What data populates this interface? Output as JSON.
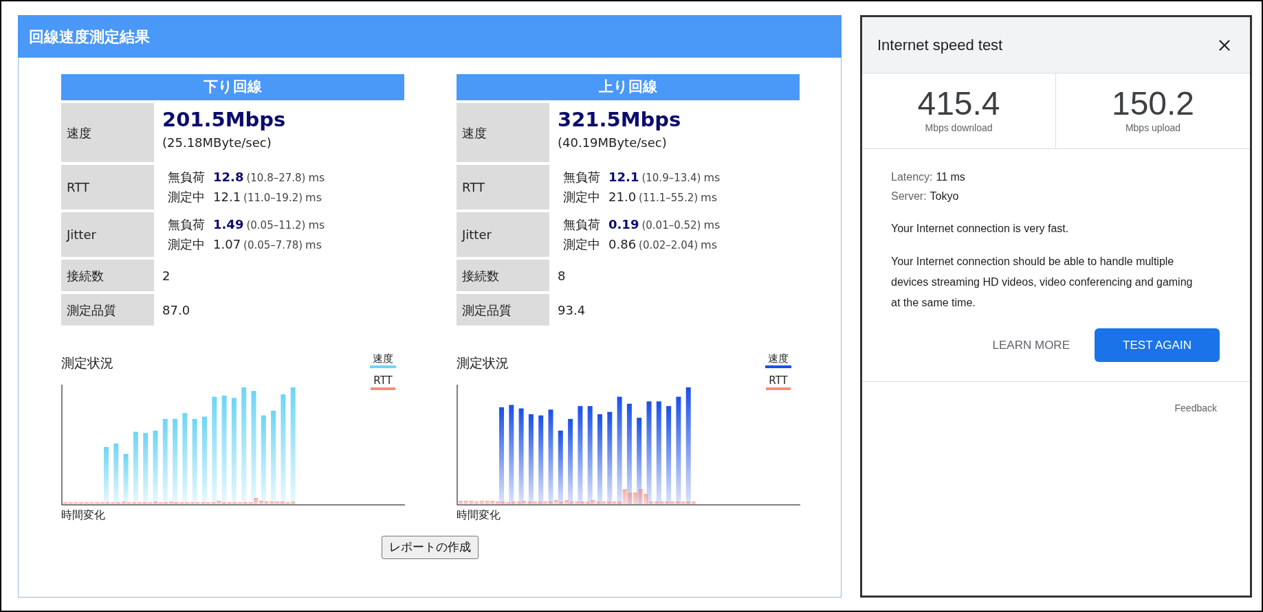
{
  "result_panel": {
    "title": "回線速度測定結果",
    "sections": [
      {
        "heading": "下り回線",
        "rows": [
          {
            "kind": "speed",
            "label": "速度",
            "value": "201.5Mbps",
            "sub": "(25.18MByte/sec)"
          },
          {
            "kind": "pair",
            "label": "RTT",
            "lines": [
              {
                "label": "無負荷",
                "value": "12.8",
                "range": "(10.8–27.8)",
                "unit": "ms",
                "highlight": true
              },
              {
                "label": "測定中",
                "value": "12.1",
                "range": "(11.0–19.2)",
                "unit": "ms",
                "highlight": false
              }
            ]
          },
          {
            "kind": "pair",
            "label": "Jitter",
            "lines": [
              {
                "label": "無負荷",
                "value": "1.49",
                "range": "(0.05–11.2)",
                "unit": "ms",
                "highlight": true
              },
              {
                "label": "測定中",
                "value": "1.07",
                "range": "(0.05–7.78)",
                "unit": "ms",
                "highlight": false
              }
            ]
          },
          {
            "kind": "plain",
            "label": "接続数",
            "value": "2"
          },
          {
            "kind": "plain",
            "label": "測定品質",
            "value": "87.0"
          }
        ],
        "chart": {
          "title": "測定状況",
          "xlabel": "時間変化",
          "legend": [
            {
              "label": "速度",
              "color": "#6dd5f5"
            },
            {
              "label": "RTT",
              "color": "#f88c7c"
            }
          ]
        }
      },
      {
        "heading": "上り回線",
        "rows": [
          {
            "kind": "speed",
            "label": "速度",
            "value": "321.5Mbps",
            "sub": "(40.19MByte/sec)"
          },
          {
            "kind": "pair",
            "label": "RTT",
            "lines": [
              {
                "label": "無負荷",
                "value": "12.1",
                "range": "(10.9–13.4)",
                "unit": "ms",
                "highlight": true
              },
              {
                "label": "測定中",
                "value": "21.0",
                "range": "(11.1–55.2)",
                "unit": "ms",
                "highlight": false
              }
            ]
          },
          {
            "kind": "pair",
            "label": "Jitter",
            "lines": [
              {
                "label": "無負荷",
                "value": "0.19",
                "range": "(0.01–0.52)",
                "unit": "ms",
                "highlight": true
              },
              {
                "label": "測定中",
                "value": "0.86",
                "range": "(0.02–2.04)",
                "unit": "ms",
                "highlight": false
              }
            ]
          },
          {
            "kind": "plain",
            "label": "接続数",
            "value": "8"
          },
          {
            "kind": "plain",
            "label": "測定品質",
            "value": "93.4"
          }
        ],
        "chart": {
          "title": "測定状況",
          "xlabel": "時間変化",
          "legend": [
            {
              "label": "速度",
              "color": "#1a4fe8"
            },
            {
              "label": "RTT",
              "color": "#f88c7c"
            }
          ]
        }
      }
    ],
    "report_button": "レポートの作成"
  },
  "speed_test": {
    "title": "Internet speed test",
    "stats": [
      {
        "value": "415.4",
        "label": "Mbps download"
      },
      {
        "value": "150.2",
        "label": "Mbps upload"
      }
    ],
    "details": [
      {
        "label": "Latency:",
        "value": "11 ms"
      },
      {
        "label": "Server:",
        "value": "Tokyo"
      }
    ],
    "messages": [
      "Your Internet connection is very fast.",
      "Your Internet connection should be able to handle multiple devices streaming HD videos, video conferencing and gaming at the same time."
    ],
    "buttons": [
      {
        "kind": "text",
        "label": "LEARN MORE"
      },
      {
        "kind": "primary",
        "label": "TEST AGAIN"
      }
    ],
    "feedback": "Feedback"
  }
}
